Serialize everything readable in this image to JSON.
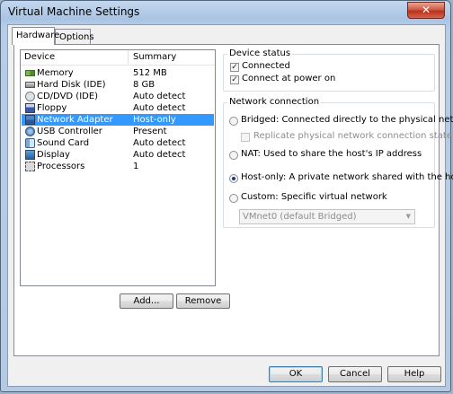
{
  "window": {
    "title": "Virtual Machine Settings",
    "close_glyph": "✕"
  },
  "tabs": [
    {
      "label": "Hardware",
      "active": true
    },
    {
      "label": "Options",
      "active": false
    }
  ],
  "device_list": {
    "headers": {
      "device": "Device",
      "summary": "Summary"
    },
    "rows": [
      {
        "name": "Memory",
        "summary": "512 MB",
        "icon": "memory-icon",
        "selected": false
      },
      {
        "name": "Hard Disk (IDE)",
        "summary": "8 GB",
        "icon": "hard-disk-icon",
        "selected": false
      },
      {
        "name": "CD/DVD (IDE)",
        "summary": "Auto detect",
        "icon": "cd-dvd-icon",
        "selected": false
      },
      {
        "name": "Floppy",
        "summary": "Auto detect",
        "icon": "floppy-icon",
        "selected": false
      },
      {
        "name": "Network Adapter",
        "summary": "Host-only",
        "icon": "network-adapter-icon",
        "selected": true
      },
      {
        "name": "USB Controller",
        "summary": "Present",
        "icon": "usb-icon",
        "selected": false
      },
      {
        "name": "Sound Card",
        "summary": "Auto detect",
        "icon": "sound-icon",
        "selected": false
      },
      {
        "name": "Display",
        "summary": "Auto detect",
        "icon": "display-icon",
        "selected": false
      },
      {
        "name": "Processors",
        "summary": "1",
        "icon": "processor-icon",
        "selected": false
      }
    ]
  },
  "list_buttons": {
    "add": "Add...",
    "remove": "Remove"
  },
  "device_status": {
    "title": "Device status",
    "connected": {
      "label": "Connected",
      "checked": true
    },
    "connect_at_power_on": {
      "label": "Connect at power on",
      "checked": true
    }
  },
  "network_connection": {
    "title": "Network connection",
    "bridged": {
      "label": "Bridged: Connected directly to the physical network",
      "selected": false
    },
    "replicate": {
      "label": "Replicate physical network connection state",
      "checked": false,
      "enabled": false
    },
    "nat": {
      "label": "NAT: Used to share the host's IP address",
      "selected": false
    },
    "host_only": {
      "label": "Host-only: A private network shared with the host",
      "selected": true
    },
    "custom": {
      "label": "Custom: Specific virtual network",
      "selected": false
    },
    "custom_network_value": "VMnet0 (default Bridged)"
  },
  "dialog_buttons": {
    "ok": "OK",
    "cancel": "Cancel",
    "help": "Help"
  },
  "colors": {
    "selection": "#3399ff",
    "title_bar": "#b4cae3",
    "close_button": "#c4402b"
  }
}
